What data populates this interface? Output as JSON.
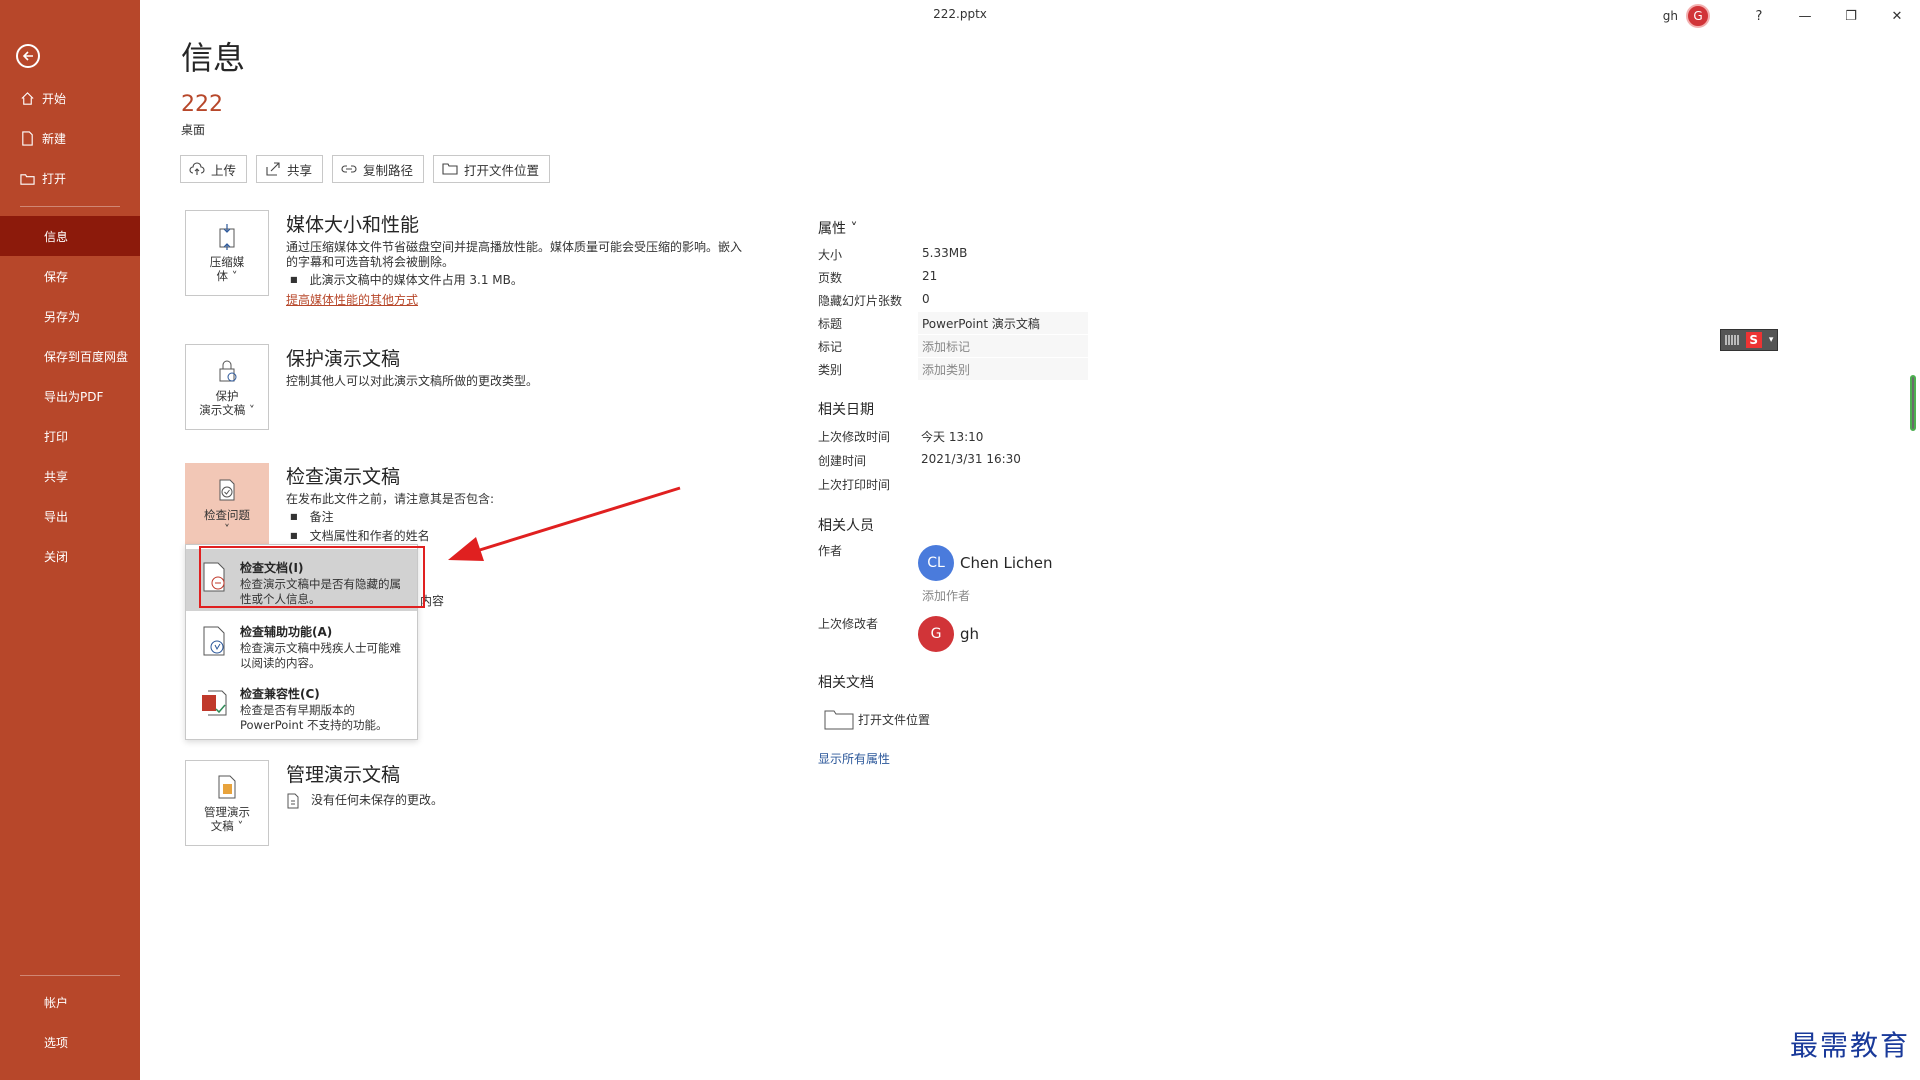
{
  "titlebar": {
    "filename": "222.pptx",
    "user": "gh",
    "avatar_letter": "G",
    "help": "?",
    "minimize": "—",
    "restore": "❐",
    "close": "✕"
  },
  "sidebar": {
    "items": [
      {
        "label": "开始",
        "icon": "home-icon"
      },
      {
        "label": "新建",
        "icon": "new-file-icon"
      },
      {
        "label": "打开",
        "icon": "folder-open-icon"
      },
      {
        "label": "信息"
      },
      {
        "label": "保存"
      },
      {
        "label": "另存为"
      },
      {
        "label": "保存到百度网盘"
      },
      {
        "label": "导出为PDF"
      },
      {
        "label": "打印"
      },
      {
        "label": "共享"
      },
      {
        "label": "导出"
      },
      {
        "label": "关闭"
      }
    ],
    "bottom": [
      {
        "label": "帐户"
      },
      {
        "label": "选项"
      }
    ],
    "active": "信息"
  },
  "main": {
    "title": "信息",
    "file_name": "222",
    "file_location": "桌面",
    "actions": [
      {
        "label": "上传",
        "icon": "cloud-upload-icon"
      },
      {
        "label": "共享",
        "icon": "share-icon"
      },
      {
        "label": "复制路径",
        "icon": "link-icon"
      },
      {
        "label": "打开文件位置",
        "icon": "folder-icon"
      }
    ],
    "media": {
      "tile_label_1": "压缩媒",
      "tile_label_2": "体 ˅",
      "title": "媒体大小和性能",
      "desc_1": "通过压缩媒体文件节省磁盘空间并提高播放性能。媒体质量可能会受压缩的影响。嵌入",
      "desc_2": "的字幕和可选音轨将会被删除。",
      "bullet": "此演示文稿中的媒体文件占用 3.1 MB。",
      "link": "提高媒体性能的其他方式"
    },
    "protect": {
      "tile_label_1": "保护",
      "tile_label_2": "演示文稿 ˅",
      "title": "保护演示文稿",
      "desc": "控制其他人可以对此演示文稿所做的更改类型。"
    },
    "inspect": {
      "tile_label_1": "检查问题",
      "tile_label_2": "˅",
      "title": "检查演示文稿",
      "desc": "在发布此文件之前，请注意其是否包含:",
      "bullet_1": "备注",
      "bullet_2": "文档属性和作者的姓名",
      "peek": "内容"
    },
    "dropdown": [
      {
        "title": "检查文档(I)",
        "desc": "检查演示文稿中是否有隐藏的属性或个人信息。"
      },
      {
        "title": "检查辅助功能(A)",
        "desc": "检查演示文稿中残疾人士可能难以阅读的内容。"
      },
      {
        "title": "检查兼容性(C)",
        "desc": "检查是否有早期版本的 PowerPoint 不支持的功能。"
      }
    ],
    "manage": {
      "tile_label_1": "管理演示",
      "tile_label_2": "文稿 ˅",
      "title": "管理演示文稿",
      "desc": "没有任何未保存的更改。"
    }
  },
  "properties": {
    "header": "属性 ˅",
    "rows": [
      {
        "label": "大小",
        "value": "5.33MB"
      },
      {
        "label": "页数",
        "value": "21"
      },
      {
        "label": "隐藏幻灯片张数",
        "value": "0"
      },
      {
        "label": "标题",
        "value": "PowerPoint 演示文稿"
      },
      {
        "label": "标记",
        "value": "添加标记"
      },
      {
        "label": "类别",
        "value": "添加类别"
      }
    ],
    "dates_header": "相关日期",
    "dates": [
      {
        "label": "上次修改时间",
        "value": "今天 13:10"
      },
      {
        "label": "创建时间",
        "value": "2021/3/31 16:30"
      },
      {
        "label": "上次打印时间",
        "value": ""
      }
    ],
    "people_header": "相关人员",
    "author_label": "作者",
    "author_initials": "CL",
    "author_name": "Chen Lichen",
    "add_author": "添加作者",
    "modifier_label": "上次修改者",
    "modifier_initial": "G",
    "modifier_name": "gh",
    "docs_header": "相关文档",
    "open_location": "打开文件位置",
    "show_all": "显示所有属性"
  },
  "colors": {
    "brand": "#b7472a",
    "sidebar_active": "#8c1a0b",
    "author_avatar": "#4a7bdc",
    "modifier_avatar": "#d13438"
  },
  "watermark": "最需教育"
}
